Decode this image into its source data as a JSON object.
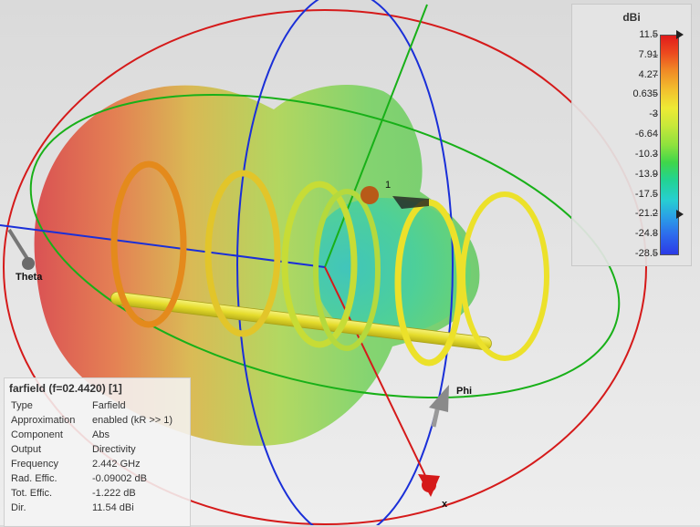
{
  "legend": {
    "unit": "dBi",
    "ticks": [
      "11.5",
      "7.91",
      "4.27",
      "0.635",
      "-3",
      "-6.64",
      "-10.3",
      "-13.9",
      "-17.5",
      "-21.2",
      "-24.8",
      "-28.5"
    ],
    "max_marker_value": "11.5",
    "current_marker_value": "-21.2",
    "colors": [
      "#e11b1b",
      "#f08a26",
      "#eeea34",
      "#8ee23d",
      "#22d392",
      "#27cfd0",
      "#2d6bec",
      "#2b3ae6"
    ]
  },
  "axes": {
    "theta": "Theta",
    "phi": "Phi",
    "x": "x"
  },
  "probe_label": "1",
  "info": {
    "title": "farfield (f=02.4420) [1]",
    "rows": [
      {
        "key": "Type",
        "value": "Farfield"
      },
      {
        "key": "Approximation",
        "value": "enabled (kR >> 1)"
      },
      {
        "key": "Component",
        "value": "Abs"
      },
      {
        "key": "Output",
        "value": "Directivity"
      },
      {
        "key": "Frequency",
        "value": "2.442 GHz"
      },
      {
        "key": "Rad. Effic.",
        "value": "-0.09002 dB"
      },
      {
        "key": "Tot. Effic.",
        "value": "-1.222 dB"
      },
      {
        "key": "Dir.",
        "value": "11.54 dBi"
      }
    ]
  }
}
